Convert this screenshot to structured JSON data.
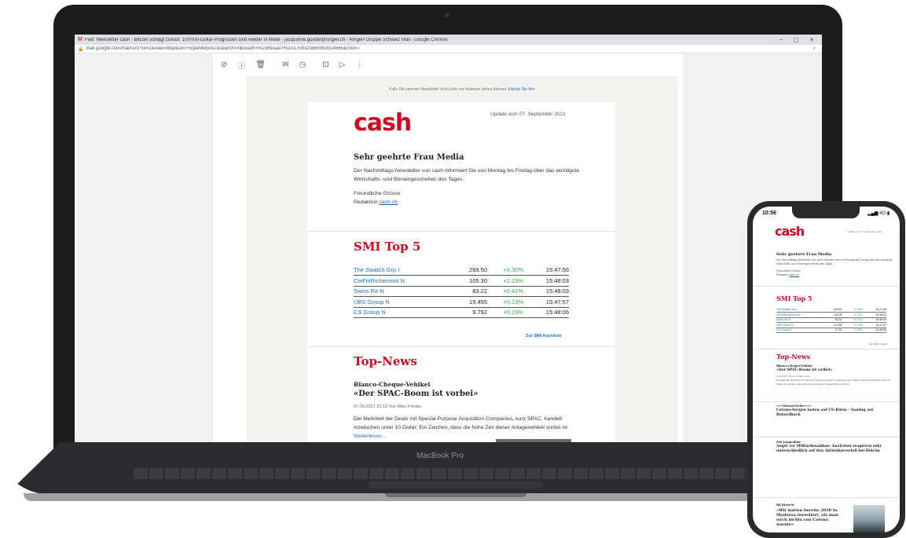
{
  "browser": {
    "tab_title": "Fwd: Newsletter cash - Bitcoin schlägt zurück: 100'000-Dollar-Prognosen sind wieder in Mode - jacqueline.guedel@ringier.ch - Ringier Gruppe Schweiz Mail - Google Chrome",
    "url": "mail.google.com/mail/u/0/?ui=2&view=btop&ver=5cpw9b8jsni2&search=inbox&th=%23thread-f%3A1708323885993014665&cvid=7",
    "controls": [
      "–",
      "▢",
      "✕"
    ]
  },
  "gmail_toolbar": {
    "icons": [
      "archive-icon",
      "report-spam-icon",
      "delete-icon",
      "mark-unread-icon",
      "snooze-icon",
      "move-to-icon",
      "label-icon",
      "more-icon"
    ]
  },
  "newsletter": {
    "preheader_text": "Falls Sie unseren Newsletter nicht oder nur teilweise sehen können, ",
    "preheader_link": "klicken Sie hier",
    "logo": "cash",
    "update_date": "Update vom 07. September 2021",
    "greeting": "Sehr geehrte Frau Media",
    "intro": "Der Nachmittags-Newsletter von cash informiert Sie von Montag bis Freitag über das wichtigste Wirtschafts- und Börsengeschehen des Tages.",
    "signoff": "Freundliche Grüsse",
    "signature_prefix": "Redaktion ",
    "signature_link": "cash.ch",
    "smi_title": "SMI Top 5",
    "smi_rows": [
      {
        "name": "The Swatch Grp I",
        "price": "269.50",
        "change": "+3.30%",
        "time": "15:47:56"
      },
      {
        "name": "CieFinRichemont N",
        "price": "105.30",
        "change": "+2.23%",
        "time": "15:48:03"
      },
      {
        "name": "Swiss Re N",
        "price": "83.22",
        "change": "+0.41%",
        "time": "15:48:03"
      },
      {
        "name": "UBS Group N",
        "price": "15.455",
        "change": "+0.23%",
        "time": "15:47:57"
      },
      {
        "name": "CS Group N",
        "price": "9.792",
        "change": "+0.23%",
        "time": "15:48:06"
      }
    ],
    "smi_link": "Zur SMI-Kursliste",
    "news_title": "Top-News",
    "news_kicker": "Blanco-Cheque-Vehikel",
    "news_headline": "«Der SPAC-Boom ist vorbei»",
    "news_meta": "07.09.2021 15:13   Von Marc Forster",
    "news_body": "Die Mehrheit der Deals mit Special Purpose Acquisition Companies, kurz SPAC, handelt inzwischen unter 10 Dollar: Ein Zeichen, dass die hohe Zeit dieser Anlagevehikel vorbei ist. ",
    "news_more": "Weiterlesen..."
  },
  "laptop_label": "MacBook Pro",
  "phone": {
    "time": "10:56",
    "signal": "4G",
    "news": [
      {
        "kicker": "Blanco-Cheque-Vehikel",
        "headline": "«Der SPAC-Boom ist vorbei»"
      },
      {
        "kicker": "+++Börsen-Ticker+++",
        "headline": "Corona-Sorgen lasten auf US-Börse - Nasdaq auf Rekordhoch"
      },
      {
        "kicker": "Exit Jungenblut",
        "headline": "Angst vor Milliardenabbau: Analysten reagieren sehr unterschiedlich auf den Aktienbarverfall bei Holcim"
      }
    ],
    "last_headline": "«Wir hatten bereits 2018 in Moderna investiert, als man noch nichts von Corona wusste»",
    "last_kicker": "Bil Biotech:"
  }
}
